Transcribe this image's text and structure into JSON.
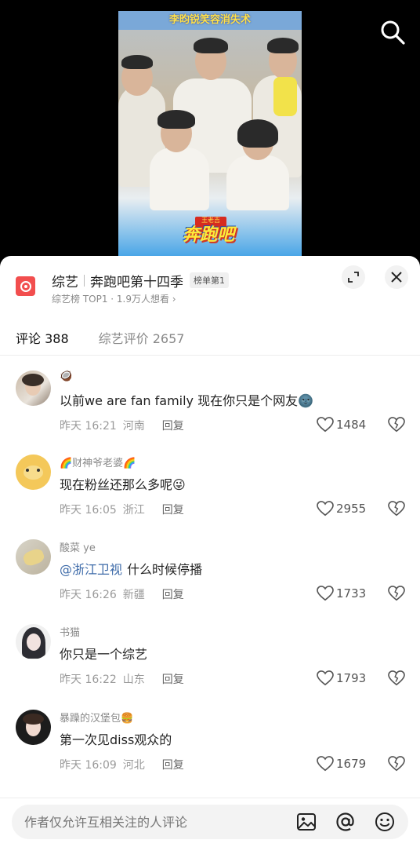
{
  "video": {
    "caption": "李昀锐笑容消失术",
    "logo_text": "奔跑吧",
    "badge_text": "王老吉"
  },
  "show": {
    "category": "综艺",
    "name": "奔跑吧第十四季",
    "rank_badge": "榜单第1",
    "subtitle": "综艺榜 TOP1 · 1.9万人想看 ›",
    "icon_color": "#f24e4e"
  },
  "tabs": [
    {
      "label": "评论 388",
      "active": true
    },
    {
      "label": "综艺评价 2657",
      "active": false
    }
  ],
  "comments": [
    {
      "user": "🥥",
      "text": "以前we are fan family 现在你只是个网友🌚",
      "time": "昨天 16:21",
      "location": "河南",
      "reply": "回复",
      "likes": "1484"
    },
    {
      "user": "🌈财神爷老婆🌈",
      "text": "现在粉丝还那么多呢😜",
      "time": "昨天 16:05",
      "location": "浙江",
      "reply": "回复",
      "likes": "2955"
    },
    {
      "user": "酸菜 ye",
      "mention": "@浙江卫视",
      "text": "什么时候停播",
      "time": "昨天 16:26",
      "location": "新疆",
      "reply": "回复",
      "likes": "1733"
    },
    {
      "user": "书猫",
      "text": "你只是一个综艺",
      "time": "昨天 16:22",
      "location": "山东",
      "reply": "回复",
      "likes": "1793"
    },
    {
      "user": "暴躁的汉堡包🍔",
      "text": "第一次见diss观众的",
      "time": "昨天 16:09",
      "location": "河北",
      "reply": "回复",
      "likes": "1679"
    }
  ],
  "input": {
    "placeholder": "作者仅允许互相关注的人评论"
  },
  "colors": {
    "mention": "#3e6ba9",
    "muted": "#9a9a9a"
  }
}
